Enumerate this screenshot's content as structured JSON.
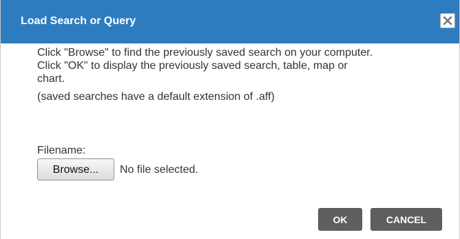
{
  "dialog": {
    "title": "Load Search or Query",
    "close_icon": "close-icon",
    "instructions": {
      "line1": "Click \"Browse\" to find the previously saved search on your computer.",
      "line2": "Click \"OK\" to display the previously saved search, table, map or",
      "line3": "chart.",
      "note": "(saved searches have a default extension of .aff)"
    },
    "file": {
      "label": "Filename:",
      "browse_label": "Browse...",
      "status": "No file selected."
    },
    "buttons": {
      "ok": "OK",
      "cancel": "CANCEL"
    }
  },
  "colors": {
    "titlebar": "#2e7cc0",
    "action_button": "#5f5f5f",
    "text": "#333333"
  }
}
